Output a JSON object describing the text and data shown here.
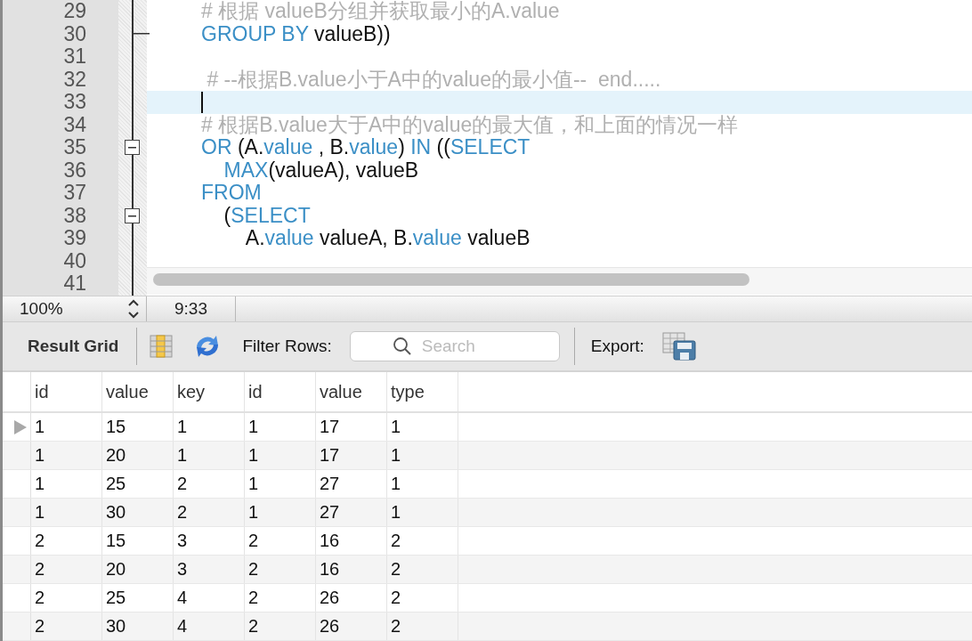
{
  "editor": {
    "lines": [
      {
        "number": "29",
        "current": false,
        "segments": [
          {
            "kind": "comment",
            "text": "# 根据 valueB分组并获取最小的A.value"
          }
        ]
      },
      {
        "number": "30",
        "current": false,
        "fold_end": true,
        "segments": [
          {
            "kind": "keyword",
            "text": "GROUP BY"
          },
          {
            "kind": "plain",
            "text": " valueB))"
          }
        ]
      },
      {
        "number": "31",
        "current": false
      },
      {
        "number": "32",
        "current": false,
        "segments": [
          {
            "kind": "comment",
            "text": " # --根据B.value小于A中的value的最小值--  end....."
          }
        ]
      },
      {
        "number": "33",
        "current": true
      },
      {
        "number": "34",
        "current": false,
        "segments": [
          {
            "kind": "comment",
            "text": "# 根据B.value大于A中的value的最大值，和上面的情况一样"
          }
        ]
      },
      {
        "number": "35",
        "current": false,
        "expanded": true,
        "segments": [
          {
            "kind": "keyword",
            "text": "OR"
          },
          {
            "kind": "plain",
            "text": " (A."
          },
          {
            "kind": "keyword",
            "text": "value"
          },
          {
            "kind": "plain",
            "text": " , B."
          },
          {
            "kind": "keyword",
            "text": "value"
          },
          {
            "kind": "plain",
            "text": ") "
          },
          {
            "kind": "keyword",
            "text": "IN"
          },
          {
            "kind": "plain",
            "text": " (("
          },
          {
            "kind": "keyword",
            "text": "SELECT"
          }
        ]
      },
      {
        "number": "36",
        "current": false,
        "segments": [
          {
            "kind": "keyword",
            "text": "    MAX"
          },
          {
            "kind": "plain",
            "text": "(valueA), valueB"
          }
        ]
      },
      {
        "number": "37",
        "current": false,
        "segments": [
          {
            "kind": "keyword",
            "text": "FROM"
          }
        ]
      },
      {
        "number": "38",
        "current": false,
        "expanded": true,
        "segments": [
          {
            "kind": "plain",
            "text": "    ("
          },
          {
            "kind": "keyword",
            "text": "SELECT"
          }
        ]
      },
      {
        "number": "39",
        "current": false,
        "segments": [
          {
            "kind": "plain",
            "text": "        A."
          },
          {
            "kind": "keyword",
            "text": "value"
          },
          {
            "kind": "plain",
            "text": " valueA, B."
          },
          {
            "kind": "keyword",
            "text": "value"
          },
          {
            "kind": "plain",
            "text": " valueB"
          }
        ]
      },
      {
        "number": "40",
        "current": false
      },
      {
        "number": "41"
      }
    ]
  },
  "status_bar": {
    "zoom": "100%",
    "position": "9:33"
  },
  "toolbar": {
    "title": "Result Grid",
    "filter_label": "Filter Rows:",
    "search": {
      "placeholder": "Search"
    },
    "export_label": "Export:"
  },
  "grid": {
    "columns": [
      "id",
      "value",
      "key",
      "id",
      "value",
      "type"
    ],
    "rows": [
      {
        "current": true,
        "cells": [
          "1",
          "15",
          "1",
          "1",
          "17",
          "1"
        ]
      },
      {
        "current": false,
        "cells": [
          "1",
          "20",
          "1",
          "1",
          "17",
          "1"
        ]
      },
      {
        "current": false,
        "cells": [
          "1",
          "25",
          "2",
          "1",
          "27",
          "1"
        ]
      },
      {
        "current": false,
        "cells": [
          "1",
          "30",
          "2",
          "1",
          "27",
          "1"
        ]
      },
      {
        "current": false,
        "cells": [
          "2",
          "15",
          "3",
          "2",
          "16",
          "2"
        ]
      },
      {
        "current": false,
        "cells": [
          "2",
          "20",
          "3",
          "2",
          "16",
          "2"
        ]
      },
      {
        "current": false,
        "cells": [
          "2",
          "25",
          "4",
          "2",
          "26",
          "2"
        ]
      },
      {
        "current": false,
        "cells": [
          "2",
          "30",
          "4",
          "2",
          "26",
          "2"
        ]
      }
    ]
  }
}
